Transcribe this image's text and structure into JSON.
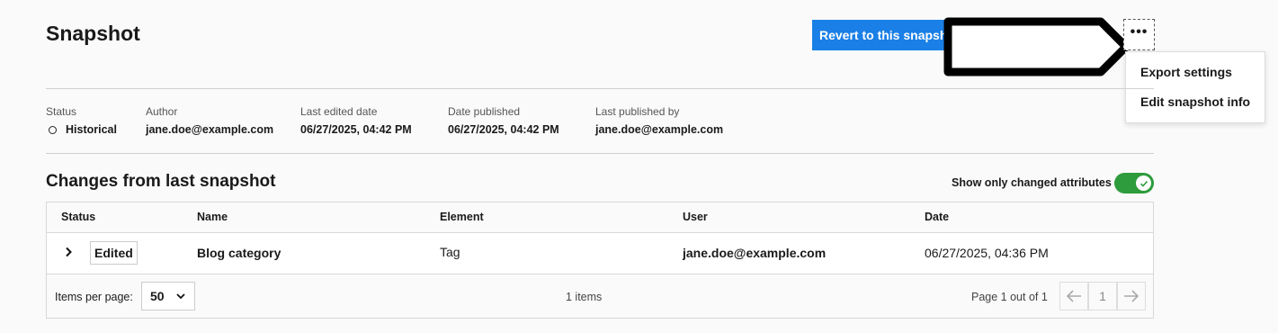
{
  "header": {
    "title": "Snapshot",
    "revert_label": "Revert to this snapshot",
    "more_label": "•••"
  },
  "menu": {
    "items": [
      {
        "label": "Export settings"
      },
      {
        "label": "Edit snapshot info"
      }
    ]
  },
  "meta": {
    "status": {
      "label": "Status",
      "value": "Historical"
    },
    "author": {
      "label": "Author",
      "value": "jane.doe@example.com"
    },
    "last_edited": {
      "label": "Last edited date",
      "value": "06/27/2025, 04:42 PM"
    },
    "date_published": {
      "label": "Date published",
      "value": "06/27/2025, 04:42 PM"
    },
    "last_published_by": {
      "label": "Last published by",
      "value": "jane.doe@example.com"
    }
  },
  "changes": {
    "title": "Changes from last snapshot",
    "toggle_label": "Show only changed attributes",
    "toggle_on": true,
    "columns": [
      "Status",
      "Name",
      "Element",
      "User",
      "Date"
    ],
    "rows": [
      {
        "status": "Edited",
        "name": "Blog category",
        "element": "Tag",
        "user": "jane.doe@example.com",
        "date": "06/27/2025, 04:36 PM"
      }
    ]
  },
  "pagination": {
    "items_per_page_label": "Items per page:",
    "items_per_page": "50",
    "items_count": "1 items",
    "page_info": "Page 1 out of 1",
    "current_page": "1"
  },
  "colors": {
    "primary": "#1a7fe6",
    "toggle_on": "#2e9b3c",
    "background": "#fafafa"
  }
}
